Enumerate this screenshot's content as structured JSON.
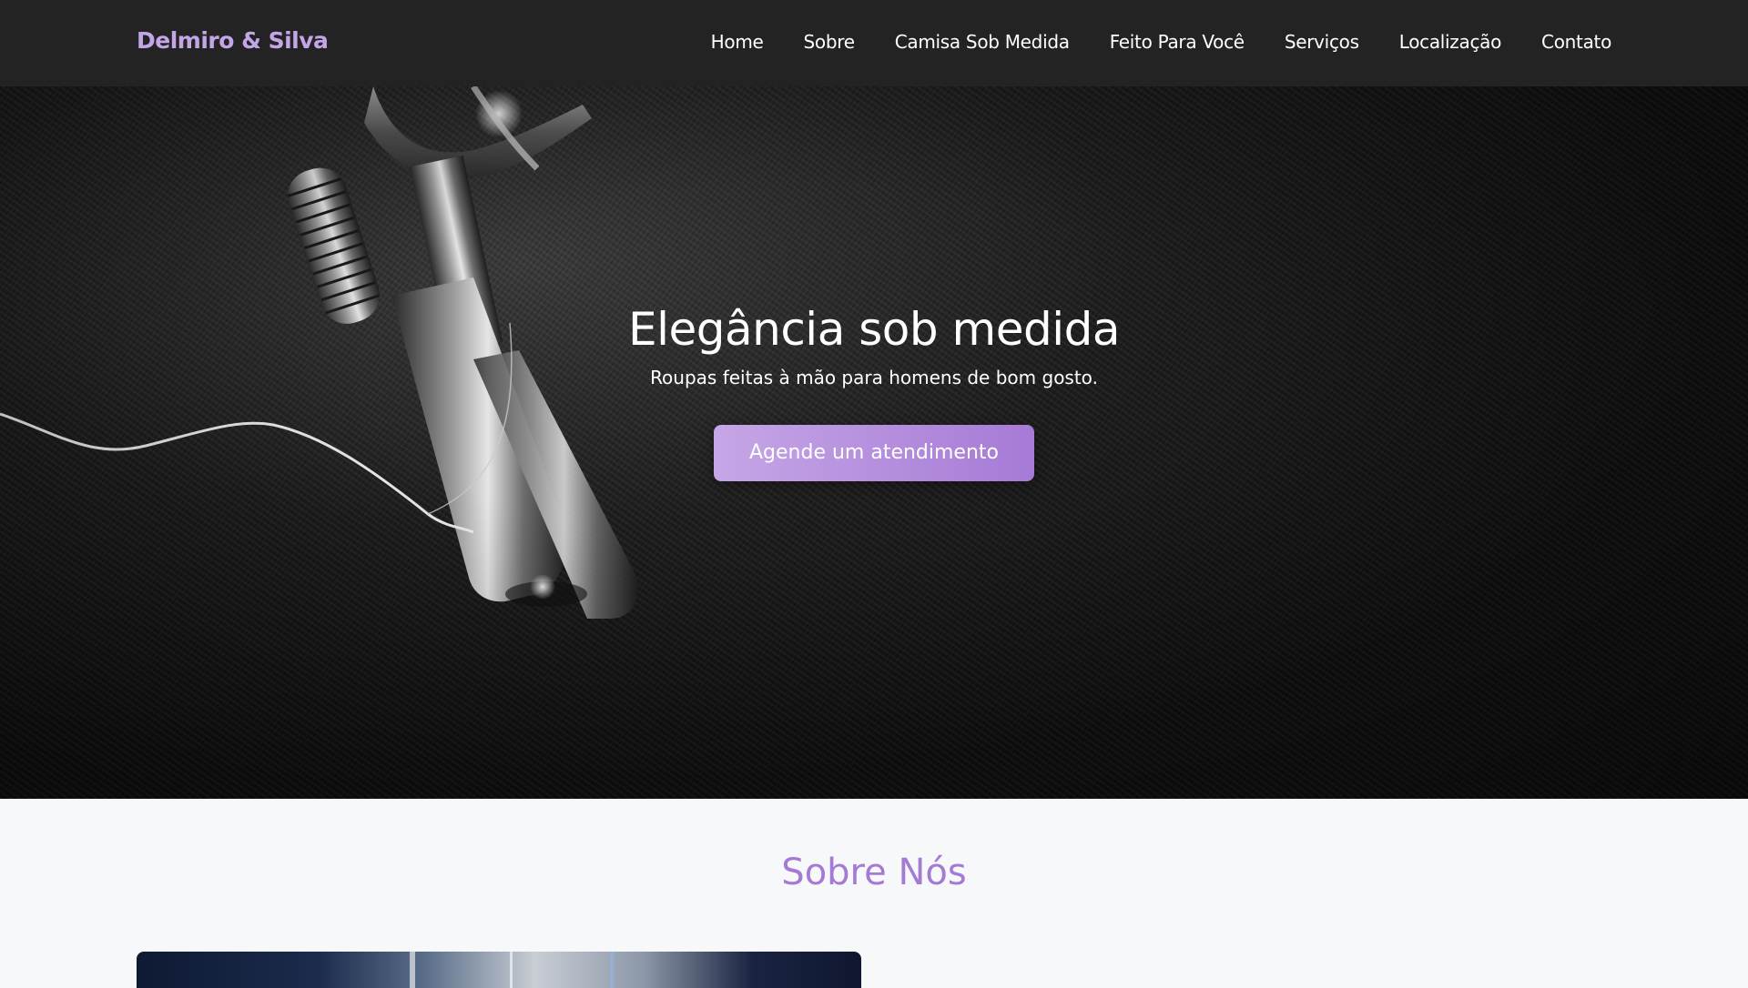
{
  "brand": {
    "name": "Delmiro & Silva",
    "color": "#c4a6e8"
  },
  "nav": {
    "items": [
      {
        "label": "Home"
      },
      {
        "label": "Sobre"
      },
      {
        "label": "Camisa Sob Medida"
      },
      {
        "label": "Feito Para Você"
      },
      {
        "label": "Serviços"
      },
      {
        "label": "Localização"
      },
      {
        "label": "Contato"
      }
    ]
  },
  "hero": {
    "title": "Elegância sob medida",
    "subtitle": "Roupas feitas à mão para homens de bom gosto.",
    "cta_label": "Agende um atendimento",
    "background_image": "sewing-machine-on-dark-fabric"
  },
  "about": {
    "title": "Sobre Nós",
    "title_color": "#a47ad4",
    "image": "tailor-workshop-photo"
  },
  "colors": {
    "navbar_bg": "#232323",
    "accent": "#b48fe0",
    "page_bg": "#f7f8fa"
  }
}
